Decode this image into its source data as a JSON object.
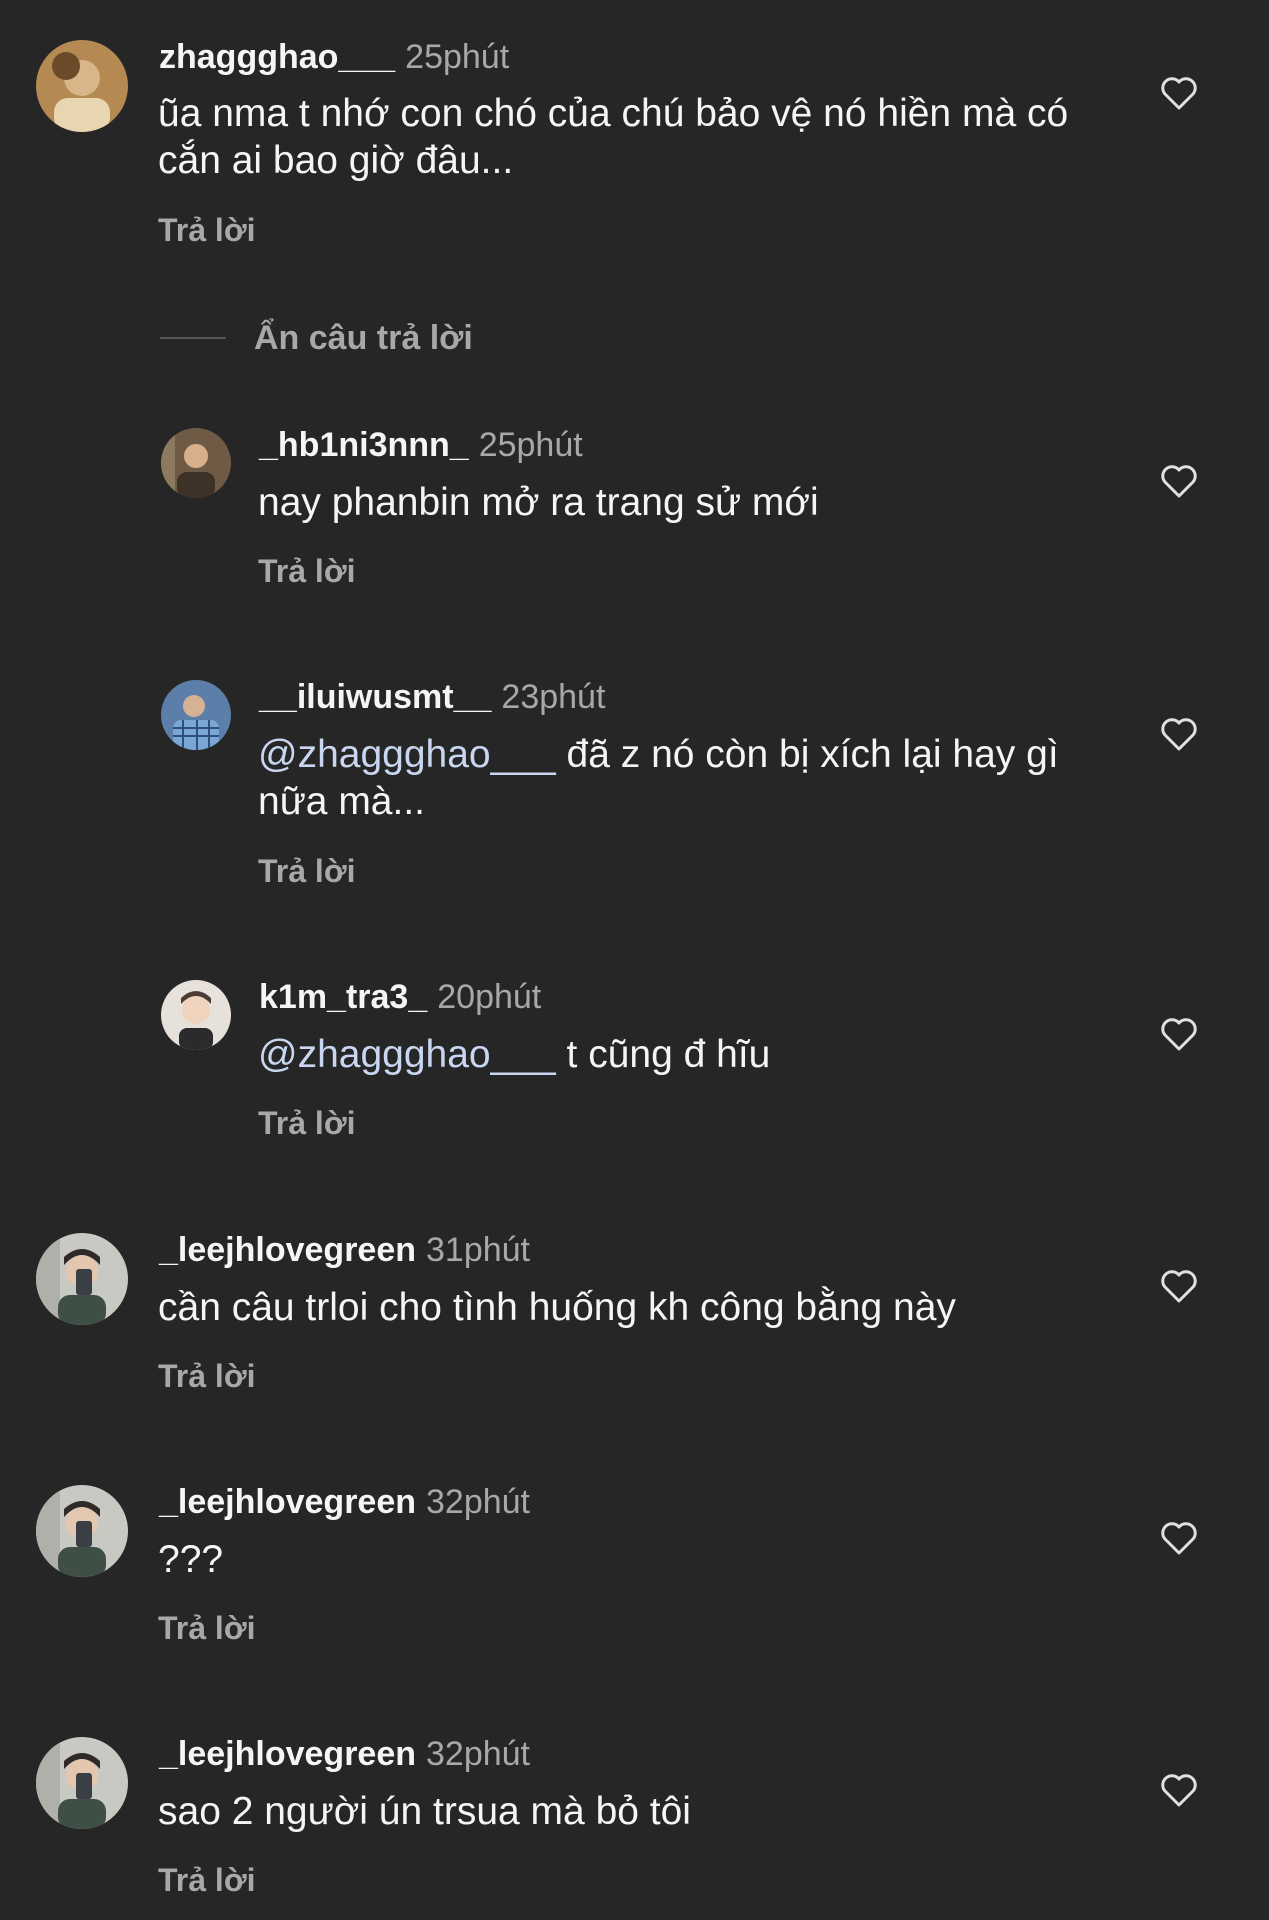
{
  "colors": {
    "background": "#262626",
    "text_primary": "#f5f5f5",
    "text_secondary": "#a8a8a8",
    "mention": "#c8d6f0"
  },
  "hide_replies_label": "Ẩn câu trả lời",
  "comments": [
    {
      "username": "zhaggghao___",
      "time": "25phút",
      "text": "ũa nma t nhớ con chó của chú bảo vệ nó hiền mà có cắn ai bao giờ đâu...",
      "reply_label": "Trả lời",
      "like_icon": "heart-outline-icon"
    },
    {
      "username": "_hb1ni3nnn_",
      "time": "25phút",
      "text": "nay phanbin mở ra trang sử mới",
      "reply_label": "Trả lời",
      "like_icon": "heart-outline-icon"
    },
    {
      "username": "__iluiwusmt__",
      "time": "23phút",
      "mention": "@zhaggghao___",
      "text": " đã z nó còn bị xích lại hay gì nữa mà...",
      "reply_label": "Trả lời",
      "like_icon": "heart-outline-icon"
    },
    {
      "username": "k1m_tra3_",
      "time": "20phút",
      "mention": "@zhaggghao___",
      "text": " t cũng đ hĩu",
      "reply_label": "Trả lời",
      "like_icon": "heart-outline-icon"
    },
    {
      "username": "_leejhlovegreen",
      "time": "31phút",
      "text": "cần câu trloi cho tình huống kh công bằng này",
      "reply_label": "Trả lời",
      "like_icon": "heart-outline-icon"
    },
    {
      "username": "_leejhlovegreen",
      "time": "32phút",
      "text": "???",
      "reply_label": "Trả lời",
      "like_icon": "heart-outline-icon"
    },
    {
      "username": "_leejhlovegreen",
      "time": "32phút",
      "text": "sao 2 người ún trsua mà bỏ tôi",
      "reply_label": "Trả lời",
      "like_icon": "heart-outline-icon"
    }
  ]
}
